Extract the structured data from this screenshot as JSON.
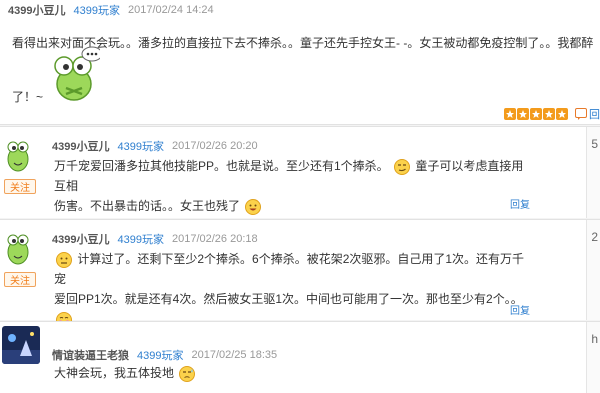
{
  "top_post": {
    "username": "4399小豆儿",
    "role": "4399玩家",
    "date": "2017/02/24 14:24",
    "text_line1": "看得出来对面不会玩。。潘多拉的直接拉下去不捧杀。。童子还先手控女王- -。女王被动都免疫控制了。。我都醉",
    "text_line2": "了！~",
    "rating_icons": [
      "star-icon",
      "star-icon",
      "star-icon",
      "star-icon",
      "star-icon"
    ],
    "reply_label": "回"
  },
  "replies": [
    {
      "username": "4399小豆儿",
      "role": "4399玩家",
      "date": "2017/02/26 20:20",
      "follow_label": "关注",
      "line1_a": "万千宠爱回潘多拉其他技能PP。也就是说。至少还有1个捧杀。",
      "line1_b": "童子可以考虑直接用互相",
      "line2": "伤害。不出暴击的话。。女王也残了",
      "reply_label": "回复",
      "side_glyph": "5"
    },
    {
      "username": "4399小豆儿",
      "role": "4399玩家",
      "date": "2017/02/26 20:18",
      "follow_label": "关注",
      "line1": "计算过了。还剩下至少2个捧杀。6个捧杀。被花架2次驱邪。自己用了1次。还有万千宠",
      "line2": "爱回PP1次。就是还有4次。然后被女王驱1次。中间也可能用了一次。那也至少有2个。。",
      "reply_label": "回复",
      "side_glyph": "2"
    },
    {
      "username": "情谊装逼王老狼",
      "role": "4399玩家",
      "date": "2017/02/25 18:35",
      "line1": "大神会玩，我五体投地",
      "side_glyph": "h"
    }
  ]
}
